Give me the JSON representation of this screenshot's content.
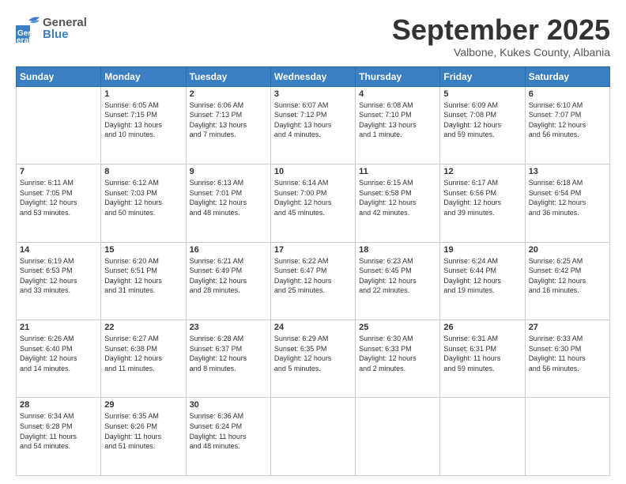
{
  "header": {
    "logo_general": "General",
    "logo_blue": "Blue",
    "month": "September 2025",
    "location": "Valbone, Kukes County, Albania"
  },
  "weekdays": [
    "Sunday",
    "Monday",
    "Tuesday",
    "Wednesday",
    "Thursday",
    "Friday",
    "Saturday"
  ],
  "weeks": [
    [
      {
        "day": "",
        "info": ""
      },
      {
        "day": "1",
        "info": "Sunrise: 6:05 AM\nSunset: 7:15 PM\nDaylight: 13 hours\nand 10 minutes."
      },
      {
        "day": "2",
        "info": "Sunrise: 6:06 AM\nSunset: 7:13 PM\nDaylight: 13 hours\nand 7 minutes."
      },
      {
        "day": "3",
        "info": "Sunrise: 6:07 AM\nSunset: 7:12 PM\nDaylight: 13 hours\nand 4 minutes."
      },
      {
        "day": "4",
        "info": "Sunrise: 6:08 AM\nSunset: 7:10 PM\nDaylight: 13 hours\nand 1 minute."
      },
      {
        "day": "5",
        "info": "Sunrise: 6:09 AM\nSunset: 7:08 PM\nDaylight: 12 hours\nand 59 minutes."
      },
      {
        "day": "6",
        "info": "Sunrise: 6:10 AM\nSunset: 7:07 PM\nDaylight: 12 hours\nand 56 minutes."
      }
    ],
    [
      {
        "day": "7",
        "info": "Sunrise: 6:11 AM\nSunset: 7:05 PM\nDaylight: 12 hours\nand 53 minutes."
      },
      {
        "day": "8",
        "info": "Sunrise: 6:12 AM\nSunset: 7:03 PM\nDaylight: 12 hours\nand 50 minutes."
      },
      {
        "day": "9",
        "info": "Sunrise: 6:13 AM\nSunset: 7:01 PM\nDaylight: 12 hours\nand 48 minutes."
      },
      {
        "day": "10",
        "info": "Sunrise: 6:14 AM\nSunset: 7:00 PM\nDaylight: 12 hours\nand 45 minutes."
      },
      {
        "day": "11",
        "info": "Sunrise: 6:15 AM\nSunset: 6:58 PM\nDaylight: 12 hours\nand 42 minutes."
      },
      {
        "day": "12",
        "info": "Sunrise: 6:17 AM\nSunset: 6:56 PM\nDaylight: 12 hours\nand 39 minutes."
      },
      {
        "day": "13",
        "info": "Sunrise: 6:18 AM\nSunset: 6:54 PM\nDaylight: 12 hours\nand 36 minutes."
      }
    ],
    [
      {
        "day": "14",
        "info": "Sunrise: 6:19 AM\nSunset: 6:53 PM\nDaylight: 12 hours\nand 33 minutes."
      },
      {
        "day": "15",
        "info": "Sunrise: 6:20 AM\nSunset: 6:51 PM\nDaylight: 12 hours\nand 31 minutes."
      },
      {
        "day": "16",
        "info": "Sunrise: 6:21 AM\nSunset: 6:49 PM\nDaylight: 12 hours\nand 28 minutes."
      },
      {
        "day": "17",
        "info": "Sunrise: 6:22 AM\nSunset: 6:47 PM\nDaylight: 12 hours\nand 25 minutes."
      },
      {
        "day": "18",
        "info": "Sunrise: 6:23 AM\nSunset: 6:45 PM\nDaylight: 12 hours\nand 22 minutes."
      },
      {
        "day": "19",
        "info": "Sunrise: 6:24 AM\nSunset: 6:44 PM\nDaylight: 12 hours\nand 19 minutes."
      },
      {
        "day": "20",
        "info": "Sunrise: 6:25 AM\nSunset: 6:42 PM\nDaylight: 12 hours\nand 16 minutes."
      }
    ],
    [
      {
        "day": "21",
        "info": "Sunrise: 6:26 AM\nSunset: 6:40 PM\nDaylight: 12 hours\nand 14 minutes."
      },
      {
        "day": "22",
        "info": "Sunrise: 6:27 AM\nSunset: 6:38 PM\nDaylight: 12 hours\nand 11 minutes."
      },
      {
        "day": "23",
        "info": "Sunrise: 6:28 AM\nSunset: 6:37 PM\nDaylight: 12 hours\nand 8 minutes."
      },
      {
        "day": "24",
        "info": "Sunrise: 6:29 AM\nSunset: 6:35 PM\nDaylight: 12 hours\nand 5 minutes."
      },
      {
        "day": "25",
        "info": "Sunrise: 6:30 AM\nSunset: 6:33 PM\nDaylight: 12 hours\nand 2 minutes."
      },
      {
        "day": "26",
        "info": "Sunrise: 6:31 AM\nSunset: 6:31 PM\nDaylight: 11 hours\nand 59 minutes."
      },
      {
        "day": "27",
        "info": "Sunrise: 6:33 AM\nSunset: 6:30 PM\nDaylight: 11 hours\nand 56 minutes."
      }
    ],
    [
      {
        "day": "28",
        "info": "Sunrise: 6:34 AM\nSunset: 6:28 PM\nDaylight: 11 hours\nand 54 minutes."
      },
      {
        "day": "29",
        "info": "Sunrise: 6:35 AM\nSunset: 6:26 PM\nDaylight: 11 hours\nand 51 minutes."
      },
      {
        "day": "30",
        "info": "Sunrise: 6:36 AM\nSunset: 6:24 PM\nDaylight: 11 hours\nand 48 minutes."
      },
      {
        "day": "",
        "info": ""
      },
      {
        "day": "",
        "info": ""
      },
      {
        "day": "",
        "info": ""
      },
      {
        "day": "",
        "info": ""
      }
    ]
  ]
}
